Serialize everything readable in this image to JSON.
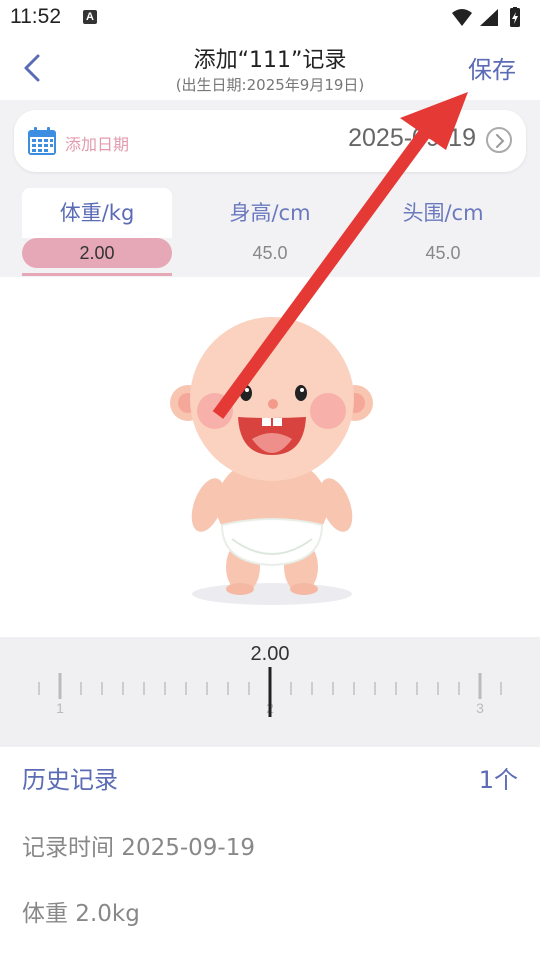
{
  "status_bar": {
    "time": "11:52",
    "notification_icon": "A"
  },
  "header": {
    "title": "添加“111”记录",
    "subtitle": "(出生日期:2025年9月19日)",
    "save_label": "保存"
  },
  "date_picker": {
    "label": "添加日期",
    "value": "2025-09-19"
  },
  "tabs": [
    {
      "label": "体重/kg",
      "value": "2.00",
      "active": true
    },
    {
      "label": "身高/cm",
      "value": "45.0",
      "active": false
    },
    {
      "label": "头围/cm",
      "value": "45.0",
      "active": false
    }
  ],
  "ruler": {
    "current_value": "2.00",
    "tick_labels": [
      "1",
      "2",
      "3"
    ]
  },
  "history": {
    "title": "历史记录",
    "count": "1个",
    "records": [
      {
        "time_text": "记录时间 2025-09-19",
        "weight_text": "体重 2.0kg"
      }
    ]
  },
  "colors": {
    "accent": "#5b6bb5",
    "pink": "#e6a8b7",
    "arrow": "#e53935"
  }
}
